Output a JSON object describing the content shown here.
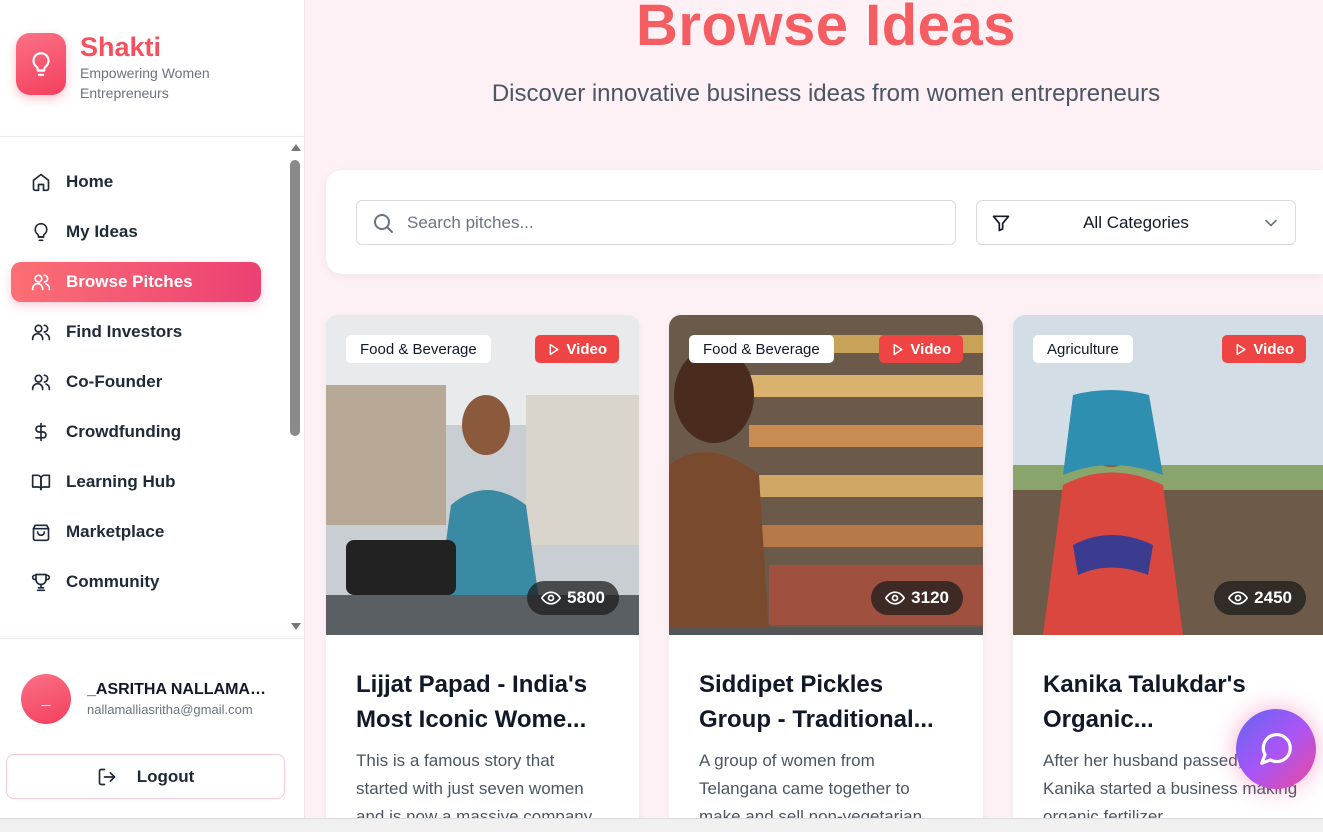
{
  "brand": {
    "name": "Shakti",
    "tagline": "Empowering Women Entrepreneurs"
  },
  "nav": [
    {
      "label": "Home",
      "icon": "home-icon"
    },
    {
      "label": "My Ideas",
      "icon": "lightbulb-icon"
    },
    {
      "label": "Browse Pitches",
      "icon": "users-icon",
      "active": true
    },
    {
      "label": "Find Investors",
      "icon": "users-icon"
    },
    {
      "label": "Co-Founder",
      "icon": "users-icon"
    },
    {
      "label": "Crowdfunding",
      "icon": "dollar-icon"
    },
    {
      "label": "Learning Hub",
      "icon": "book-icon"
    },
    {
      "label": "Marketplace",
      "icon": "shopping-bag-icon"
    },
    {
      "label": "Community",
      "icon": "trophy-icon"
    }
  ],
  "user": {
    "initial": "_",
    "name": "_ASRITHA NALLAMALLI",
    "email": "nallamalliasritha@gmail.com"
  },
  "logout_label": "Logout",
  "page": {
    "title": "Browse Ideas",
    "subtitle": "Discover innovative business ideas from women entrepreneurs"
  },
  "filters": {
    "search_placeholder": "Search pitches...",
    "category_selected": "All Categories"
  },
  "cards": [
    {
      "category": "Food & Beverage",
      "video_label": "Video",
      "views": "5800",
      "title": "Lijjat Papad - India's Most Iconic Wome...",
      "description": "This is a famous story that started with just seven women and is now a massive company..."
    },
    {
      "category": "Food & Beverage",
      "video_label": "Video",
      "views": "3120",
      "title": "Siddipet Pickles Group - Traditional...",
      "description": "A group of women from Telangana came together to make and sell non-vegetarian..."
    },
    {
      "category": "Agriculture",
      "video_label": "Video",
      "views": "2450",
      "title": "Kanika Talukdar's Organic...",
      "description": "After her husband passed, Kanika started a business making organic fertilizer..."
    }
  ],
  "colors": {
    "accent": "#f4505e",
    "video_badge": "#ef4444"
  }
}
